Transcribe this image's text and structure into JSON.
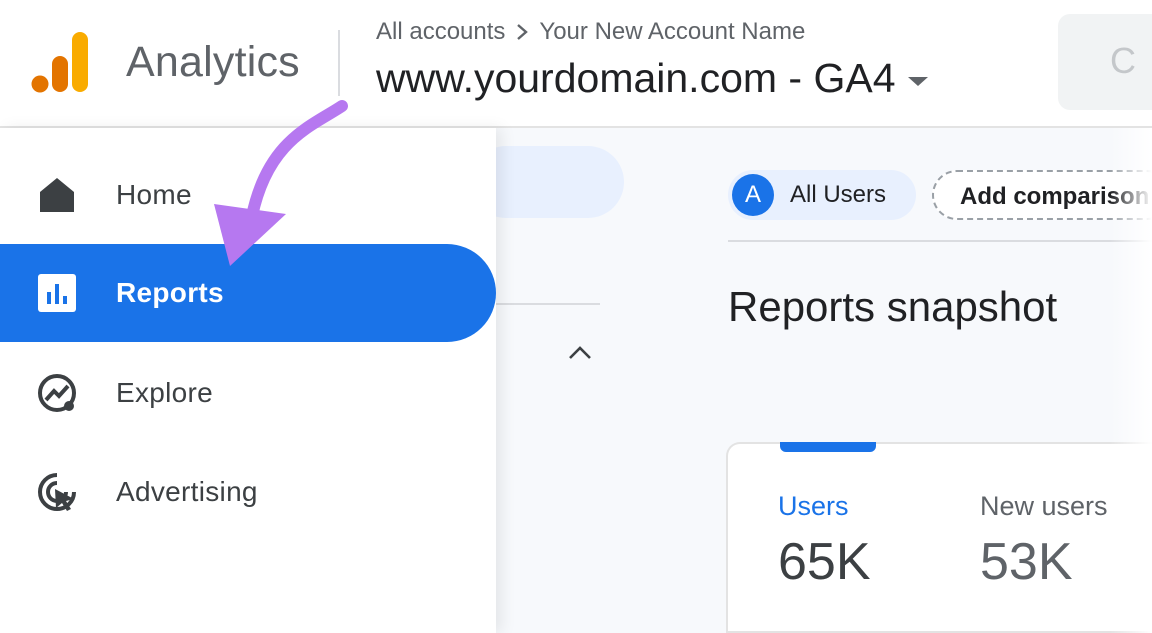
{
  "header": {
    "app_title": "Analytics",
    "breadcrumb": {
      "root": "All accounts",
      "account": "Your New Account Name"
    },
    "property": "www.yourdomain.com - GA4",
    "search_partial": "C"
  },
  "sidebar": {
    "items": [
      {
        "label": "Home",
        "icon": "home-icon"
      },
      {
        "label": "Reports",
        "icon": "bar-chart-icon",
        "active": true
      },
      {
        "label": "Explore",
        "icon": "explore-icon"
      },
      {
        "label": "Advertising",
        "icon": "advertising-icon"
      }
    ]
  },
  "main": {
    "segment": {
      "avatar_letter": "A",
      "label": "All Users"
    },
    "add_comparison": "Add comparison",
    "title": "Reports snapshot",
    "metrics": [
      {
        "label": "Users",
        "value": "65K"
      },
      {
        "label": "New users",
        "value": "53K"
      }
    ]
  },
  "colors": {
    "accent": "#1a73e8",
    "annotation_arrow": "#b678f0",
    "logo_orange": "#f9ab00",
    "logo_dark_orange": "#e37400"
  }
}
